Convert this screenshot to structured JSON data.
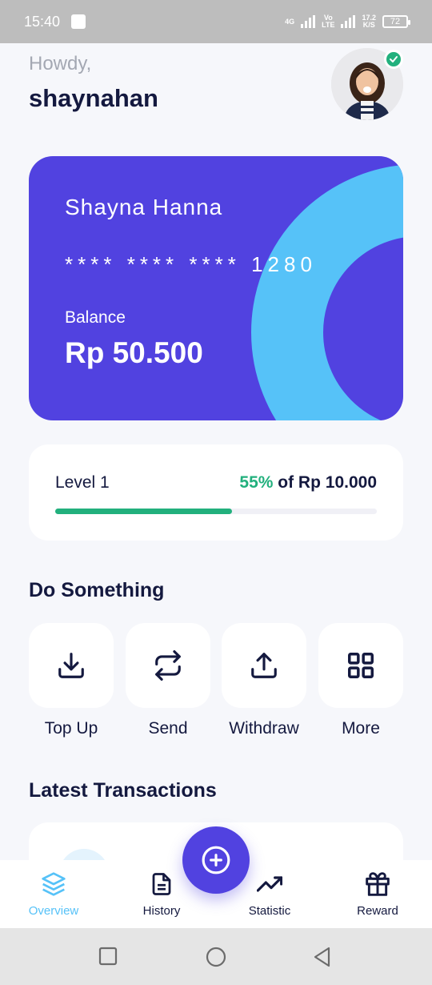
{
  "status_bar": {
    "time": "15:40",
    "network_type": "4G",
    "volte_top": "Vo",
    "volte_bottom": "LTE",
    "speed_value": "17.2",
    "speed_unit": "K/S",
    "battery": "72"
  },
  "header": {
    "greeting": "Howdy,",
    "username": "shaynahan",
    "avatar_icon": "profile-photo",
    "verified_icon": "check-badge-icon"
  },
  "card": {
    "holder_name": "Shayna Hanna",
    "number_masked": "**** **** **** 1280",
    "balance_label": "Balance",
    "balance_value": "Rp 50.500",
    "colors": {
      "primary": "#5142e0",
      "accent": "#56c2f8"
    }
  },
  "level": {
    "label": "Level 1",
    "percent_text": "55%",
    "target_text": "of Rp 10.000",
    "progress": 0.55,
    "color": "#22b07d"
  },
  "actions": {
    "title": "Do Something",
    "items": [
      {
        "label": "Top Up",
        "icon": "download-icon"
      },
      {
        "label": "Send",
        "icon": "repeat-icon"
      },
      {
        "label": "Withdraw",
        "icon": "upload-icon"
      },
      {
        "label": "More",
        "icon": "grid-icon"
      }
    ]
  },
  "transactions": {
    "title": "Latest Transactions"
  },
  "bottom_nav": {
    "items": [
      {
        "label": "Overview",
        "icon": "layers-icon",
        "active": true
      },
      {
        "label": "History",
        "icon": "document-icon",
        "active": false
      },
      {
        "label": "Statistic",
        "icon": "trending-up-icon",
        "active": false
      },
      {
        "label": "Reward",
        "icon": "gift-icon",
        "active": false
      }
    ],
    "fab_icon": "plus-circle-icon"
  }
}
